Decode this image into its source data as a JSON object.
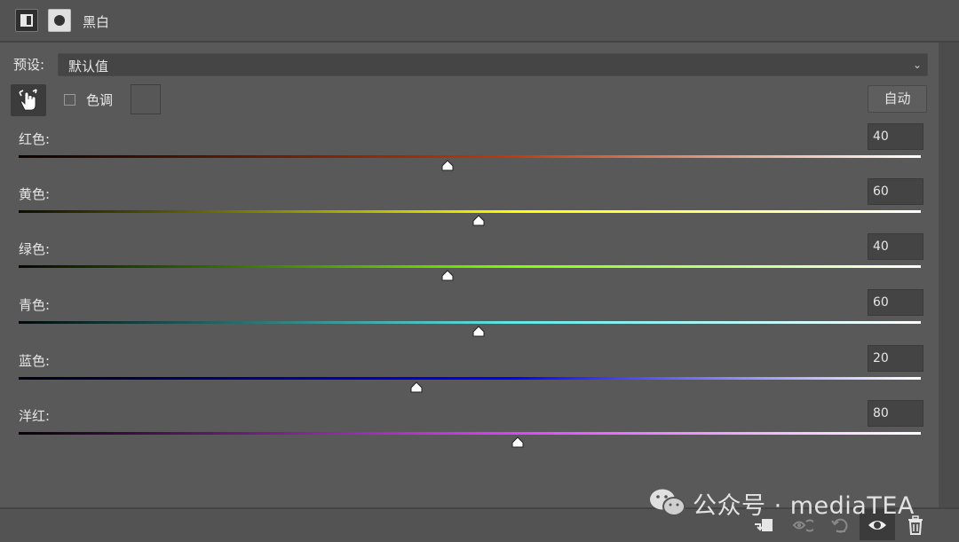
{
  "header": {
    "title": "黑白"
  },
  "preset": {
    "label": "预设:",
    "value": "默认值"
  },
  "tint": {
    "label": "色调",
    "checked": false
  },
  "auto_label": "自动",
  "sliders": [
    {
      "label": "红色:",
      "value": "40",
      "pct": 0.475,
      "colors": [
        "#0d0200",
        "#c43a08",
        "#ffffff"
      ]
    },
    {
      "label": "黄色:",
      "value": "60",
      "pct": 0.51,
      "colors": [
        "#0d0d00",
        "#ffff00",
        "#ffffff"
      ]
    },
    {
      "label": "绿色:",
      "value": "40",
      "pct": 0.475,
      "colors": [
        "#020a00",
        "#7dff00",
        "#ffffff"
      ]
    },
    {
      "label": "青色:",
      "value": "60",
      "pct": 0.51,
      "colors": [
        "#000a0a",
        "#5fe8e8",
        "#ffffff"
      ]
    },
    {
      "label": "蓝色:",
      "value": "20",
      "pct": 0.441,
      "colors": [
        "#000010",
        "#0000ff",
        "#ffffff"
      ]
    },
    {
      "label": "洋红:",
      "value": "80",
      "pct": 0.553,
      "colors": [
        "#0a000a",
        "#e040ff",
        "#ffffff"
      ]
    }
  ],
  "watermark": "公众号 · mediaTEA",
  "footer_icons": [
    "clip-to-layer-icon",
    "view-previous-state-icon",
    "reset-icon",
    "visibility-eye-icon",
    "trash-icon"
  ],
  "colors": {
    "panel_bg": "#595959",
    "header_bg": "#535353"
  }
}
